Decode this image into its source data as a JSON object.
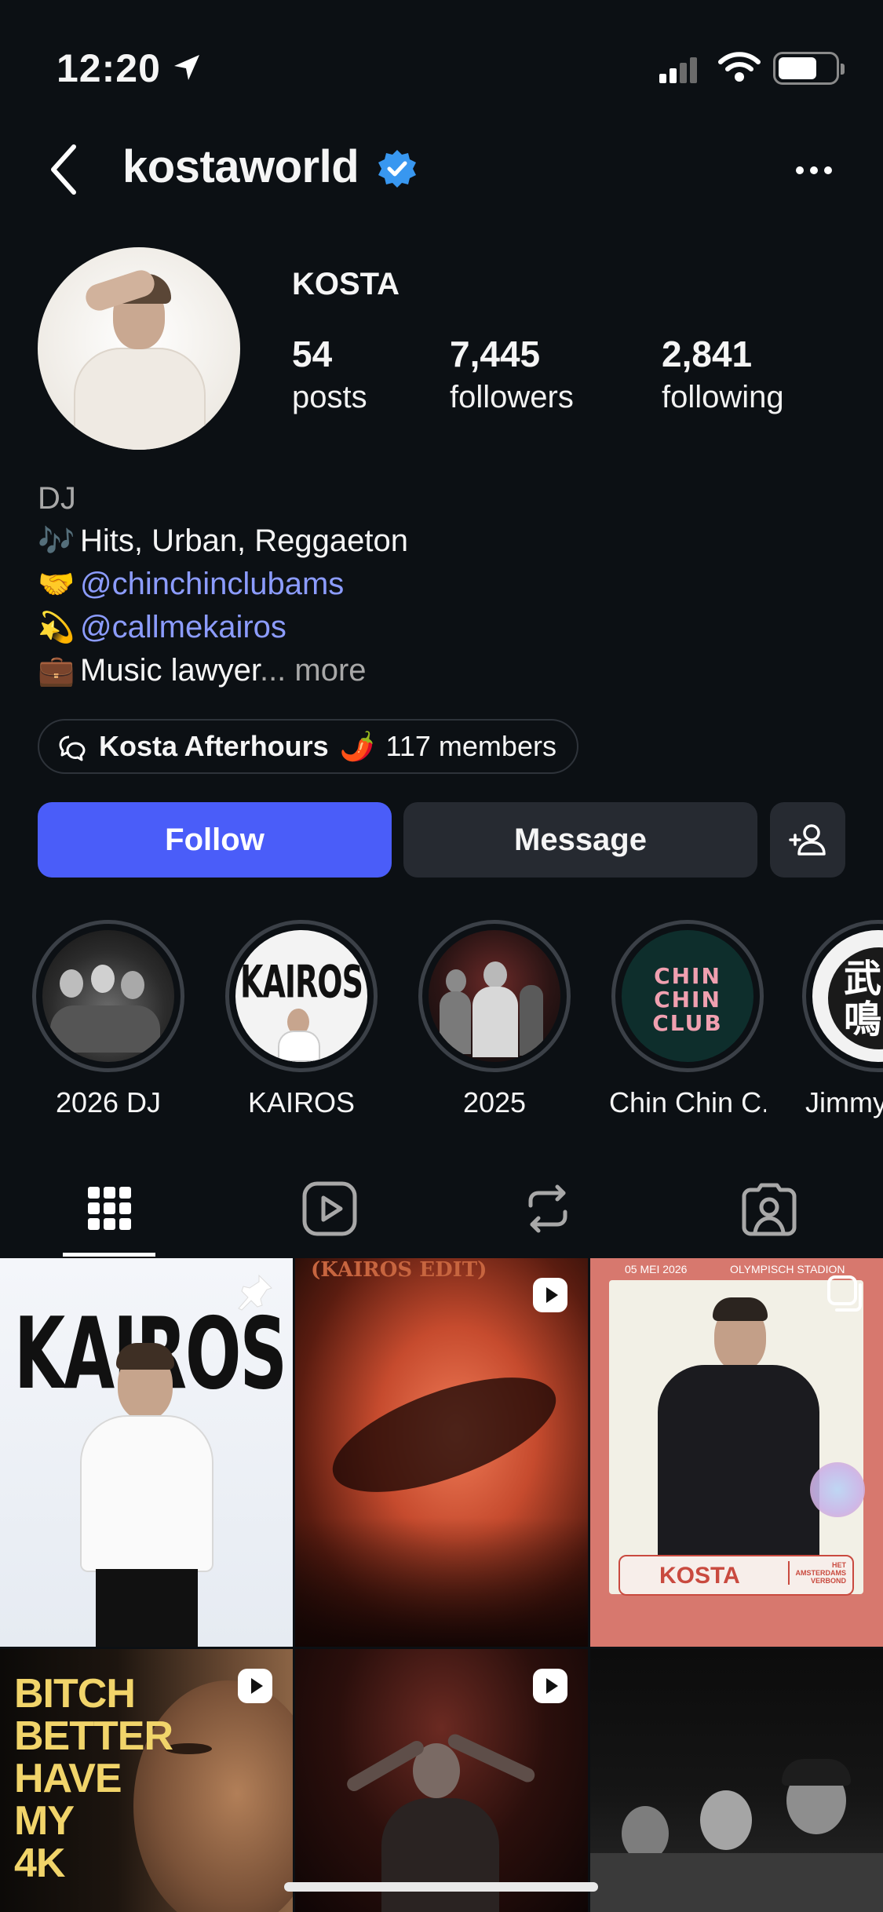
{
  "status_bar": {
    "time": "12:20"
  },
  "header": {
    "username": "kostaworld"
  },
  "profile": {
    "display_name": "KOSTA",
    "stats": [
      {
        "value": "54",
        "label": "posts"
      },
      {
        "value": "7,445",
        "label": "followers"
      },
      {
        "value": "2,841",
        "label": "following"
      }
    ],
    "category": "DJ",
    "bio": [
      {
        "emoji": "🎶",
        "text": "Hits, Urban, Reggaeton"
      },
      {
        "emoji": "🤝",
        "text": "@chinchinclubams"
      },
      {
        "emoji": "💫",
        "text": "@callmekairos"
      },
      {
        "emoji": "💼",
        "text": "Music lawyer",
        "ellipsis": "...",
        "more": "more"
      }
    ]
  },
  "channel": {
    "name": "Kosta Afterhours",
    "emoji": "🌶️",
    "members": "117 members"
  },
  "actions": {
    "follow": "Follow",
    "message": "Message"
  },
  "highlights": [
    {
      "label": "2026 DJ"
    },
    {
      "label": "KAIROS",
      "cover_text": "KAIROS"
    },
    {
      "label": "2025"
    },
    {
      "label": "Chin Chin C...",
      "cover_text": [
        "CHIN",
        "CHIN",
        "CLUB"
      ]
    },
    {
      "label": "Jimmy",
      "cover_text": [
        "武",
        "鳴"
      ]
    }
  ],
  "grid": {
    "posts": [
      {
        "text": "KAIROS"
      },
      {
        "text": "(KAIROS EDIT)"
      },
      {
        "text_top_left": "05 MEI 2026",
        "text_top_right": "OLYMPISCH STADION",
        "badge": "KOSTA",
        "badge_side": "HET AMSTERDAMS VERBOND"
      },
      {
        "text": [
          "BITCH",
          "BETTER",
          "HAVE",
          "MY",
          "4K"
        ]
      },
      {},
      {}
    ]
  },
  "colors": {
    "background": "#0c1014",
    "follow": "#4a5df9",
    "link": "#8c9cff",
    "verified": "#3897f0"
  }
}
